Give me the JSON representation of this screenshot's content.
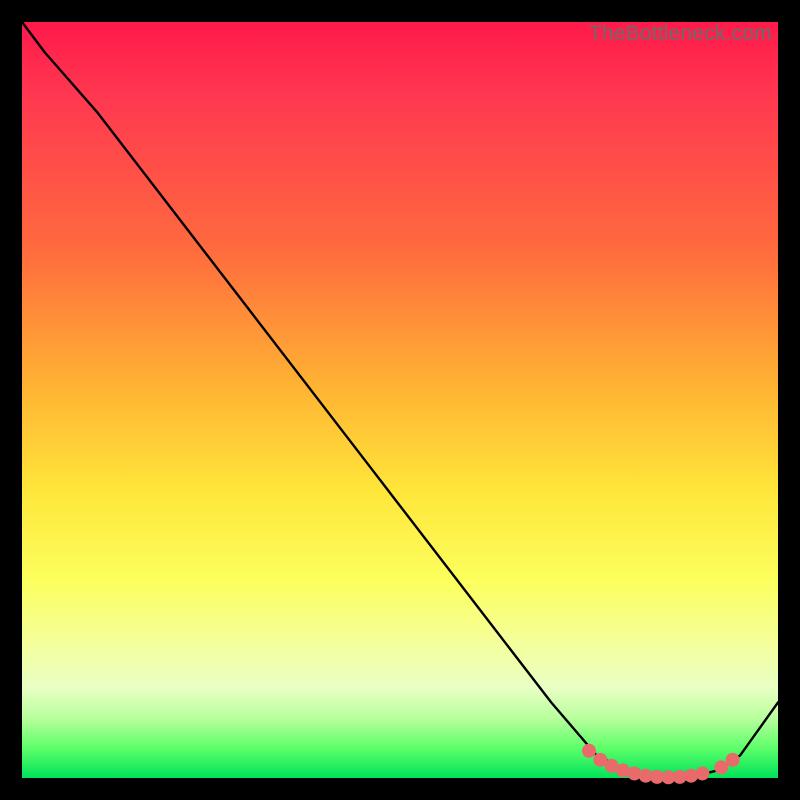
{
  "watermark": "TheBottleneck.com",
  "chart_data": {
    "type": "line",
    "title": "",
    "xlabel": "",
    "ylabel": "",
    "xlim": [
      0,
      100
    ],
    "ylim": [
      0,
      100
    ],
    "series": [
      {
        "name": "curve",
        "x": [
          0,
          3,
          10,
          20,
          30,
          40,
          50,
          60,
          70,
          76,
          80,
          84,
          88,
          92,
          95,
          100
        ],
        "y": [
          100,
          96,
          88,
          75,
          62,
          49,
          36,
          23,
          10,
          3,
          1,
          0,
          0,
          1,
          3,
          10
        ]
      }
    ],
    "highlight_dots": {
      "name": "bottleneck-range",
      "color": "#e96a6a",
      "points": [
        {
          "x": 75.0,
          "y": 3.6
        },
        {
          "x": 76.5,
          "y": 2.4
        },
        {
          "x": 78.0,
          "y": 1.6
        },
        {
          "x": 79.5,
          "y": 1.0
        },
        {
          "x": 81.0,
          "y": 0.6
        },
        {
          "x": 82.5,
          "y": 0.3
        },
        {
          "x": 84.0,
          "y": 0.15
        },
        {
          "x": 85.5,
          "y": 0.1
        },
        {
          "x": 87.0,
          "y": 0.15
        },
        {
          "x": 88.5,
          "y": 0.3
        },
        {
          "x": 90.0,
          "y": 0.6
        },
        {
          "x": 92.5,
          "y": 1.4
        },
        {
          "x": 94.0,
          "y": 2.4
        }
      ]
    }
  }
}
